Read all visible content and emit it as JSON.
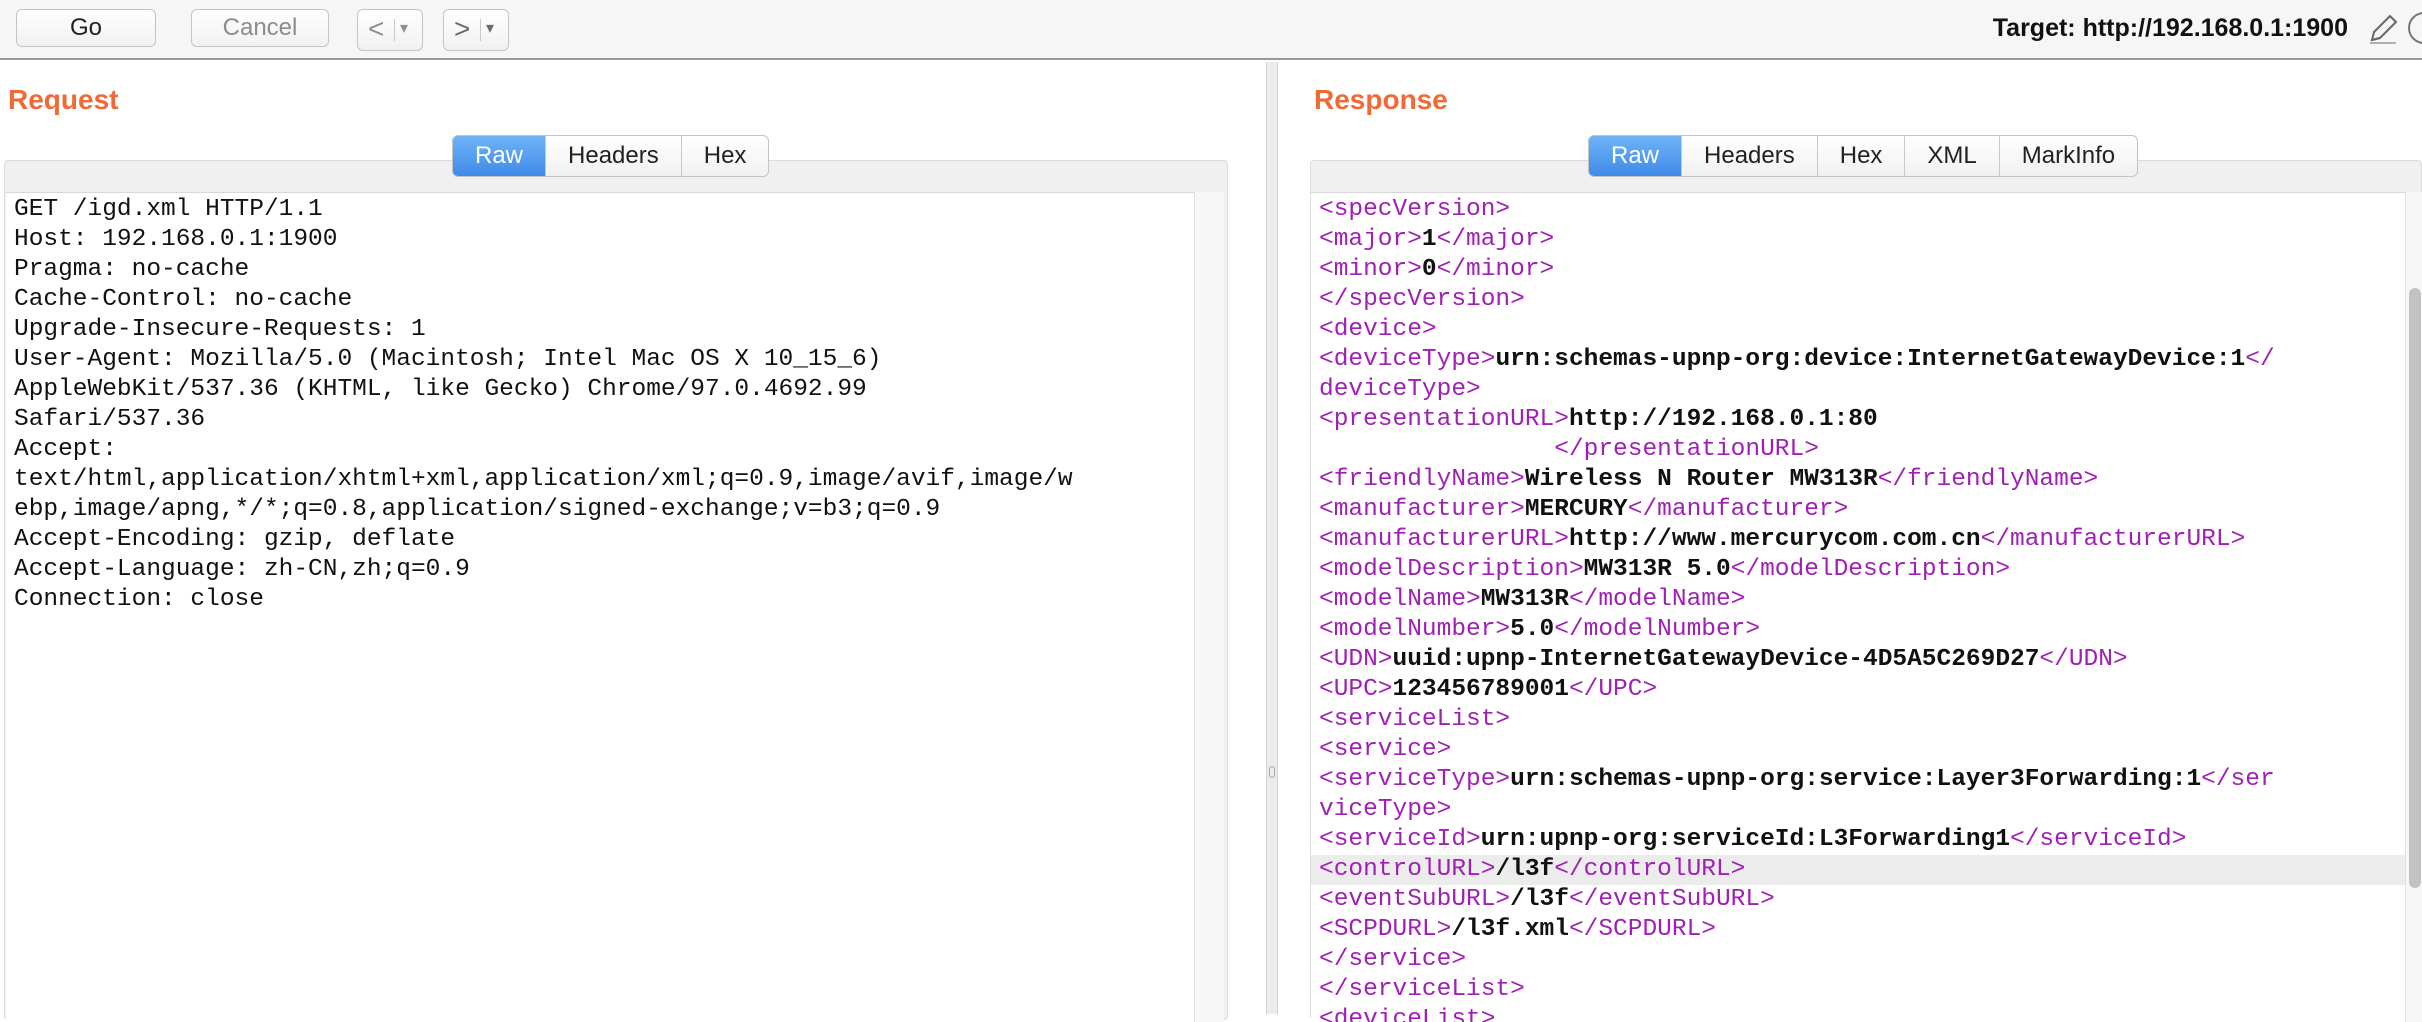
{
  "toolbar": {
    "go_label": "Go",
    "cancel_label": "Cancel",
    "back_arrow": "<",
    "forward_arrow": ">",
    "dropdown_glyph": "▾",
    "target_label": "Target: http://192.168.0.1:1900",
    "icons": [
      "pencil-icon",
      "help-icon"
    ]
  },
  "request": {
    "title": "Request",
    "tabs": [
      "Raw",
      "Headers",
      "Hex"
    ],
    "active_tab": "Raw",
    "lines": [
      "GET /igd.xml HTTP/1.1",
      "Host: 192.168.0.1:1900",
      "Pragma: no-cache",
      "Cache-Control: no-cache",
      "Upgrade-Insecure-Requests: 1",
      "User-Agent: Mozilla/5.0 (Macintosh; Intel Mac OS X 10_15_6)",
      "AppleWebKit/537.36 (KHTML, like Gecko) Chrome/97.0.4692.99",
      "Safari/537.36",
      "Accept:",
      "text/html,application/xhtml+xml,application/xml;q=0.9,image/avif,image/w",
      "ebp,image/apng,*/*;q=0.8,application/signed-exchange;v=b3;q=0.9",
      "Accept-Encoding: gzip, deflate",
      "Accept-Language: zh-CN,zh;q=0.9",
      "Connection: close"
    ]
  },
  "response": {
    "title": "Response",
    "tabs": [
      "Raw",
      "Headers",
      "Hex",
      "XML",
      "MarkInfo"
    ],
    "active_tab": "Raw",
    "tag_color": "#a01fb4",
    "lines": [
      {
        "segments": [
          [
            "t",
            "<specVersion>"
          ]
        ]
      },
      {
        "segments": [
          [
            "t",
            "<major>"
          ],
          [
            "v",
            "1"
          ],
          [
            "t",
            "</major>"
          ]
        ]
      },
      {
        "segments": [
          [
            "t",
            "<minor>"
          ],
          [
            "v",
            "0"
          ],
          [
            "t",
            "</minor>"
          ]
        ]
      },
      {
        "segments": [
          [
            "t",
            "</specVersion>"
          ]
        ]
      },
      {
        "segments": [
          [
            "t",
            "<device>"
          ]
        ]
      },
      {
        "segments": [
          [
            "t",
            "<deviceType>"
          ],
          [
            "v",
            "urn:schemas-upnp-org:device:InternetGatewayDevice:1"
          ],
          [
            "t",
            "</"
          ]
        ]
      },
      {
        "segments": [
          [
            "t",
            "deviceType>"
          ]
        ]
      },
      {
        "segments": [
          [
            "t",
            "<presentationURL>"
          ],
          [
            "v",
            "http://192.168.0.1:80"
          ]
        ]
      },
      {
        "segments": [
          [
            "v",
            "                "
          ],
          [
            "t",
            "</presentationURL>"
          ]
        ]
      },
      {
        "segments": [
          [
            "t",
            "<friendlyName>"
          ],
          [
            "v",
            "Wireless N Router MW313R"
          ],
          [
            "t",
            "</friendlyName>"
          ]
        ]
      },
      {
        "segments": [
          [
            "t",
            "<manufacturer>"
          ],
          [
            "v",
            "MERCURY"
          ],
          [
            "t",
            "</manufacturer>"
          ]
        ]
      },
      {
        "segments": [
          [
            "t",
            "<manufacturerURL>"
          ],
          [
            "v",
            "http://www.mercurycom.com.cn"
          ],
          [
            "t",
            "</manufacturerURL>"
          ]
        ]
      },
      {
        "segments": [
          [
            "t",
            "<modelDescription>"
          ],
          [
            "v",
            "MW313R 5.0"
          ],
          [
            "t",
            "</modelDescription>"
          ]
        ]
      },
      {
        "segments": [
          [
            "t",
            "<modelName>"
          ],
          [
            "v",
            "MW313R"
          ],
          [
            "t",
            "</modelName>"
          ]
        ]
      },
      {
        "segments": [
          [
            "t",
            "<modelNumber>"
          ],
          [
            "v",
            "5.0"
          ],
          [
            "t",
            "</modelNumber>"
          ]
        ]
      },
      {
        "segments": [
          [
            "t",
            "<UDN>"
          ],
          [
            "v",
            "uuid:upnp-InternetGatewayDevice-4D5A5C269D27"
          ],
          [
            "t",
            "</UDN>"
          ]
        ]
      },
      {
        "segments": [
          [
            "t",
            "<UPC>"
          ],
          [
            "v",
            "123456789001"
          ],
          [
            "t",
            "</UPC>"
          ]
        ]
      },
      {
        "segments": [
          [
            "t",
            "<serviceList>"
          ]
        ]
      },
      {
        "segments": [
          [
            "t",
            "<service>"
          ]
        ]
      },
      {
        "segments": [
          [
            "t",
            "<serviceType>"
          ],
          [
            "v",
            "urn:schemas-upnp-org:service:Layer3Forwarding:1"
          ],
          [
            "t",
            "</ser"
          ]
        ]
      },
      {
        "segments": [
          [
            "t",
            "viceType>"
          ]
        ]
      },
      {
        "segments": [
          [
            "t",
            "<serviceId>"
          ],
          [
            "v",
            "urn:upnp-org:serviceId:L3Forwarding1"
          ],
          [
            "t",
            "</serviceId>"
          ]
        ]
      },
      {
        "segments": [
          [
            "t",
            "<controlURL>"
          ],
          [
            "v",
            "/l3f"
          ],
          [
            "t",
            "</controlURL>"
          ]
        ],
        "highlight": true
      },
      {
        "segments": [
          [
            "t",
            "<eventSubURL>"
          ],
          [
            "v",
            "/l3f"
          ],
          [
            "t",
            "</eventSubURL>"
          ]
        ]
      },
      {
        "segments": [
          [
            "t",
            "<SCPDURL>"
          ],
          [
            "v",
            "/l3f.xml"
          ],
          [
            "t",
            "</SCPDURL>"
          ]
        ]
      },
      {
        "segments": [
          [
            "t",
            "</service>"
          ]
        ]
      },
      {
        "segments": [
          [
            "t",
            "</serviceList>"
          ]
        ]
      },
      {
        "segments": [
          [
            "t",
            "<deviceList>"
          ]
        ]
      }
    ]
  }
}
